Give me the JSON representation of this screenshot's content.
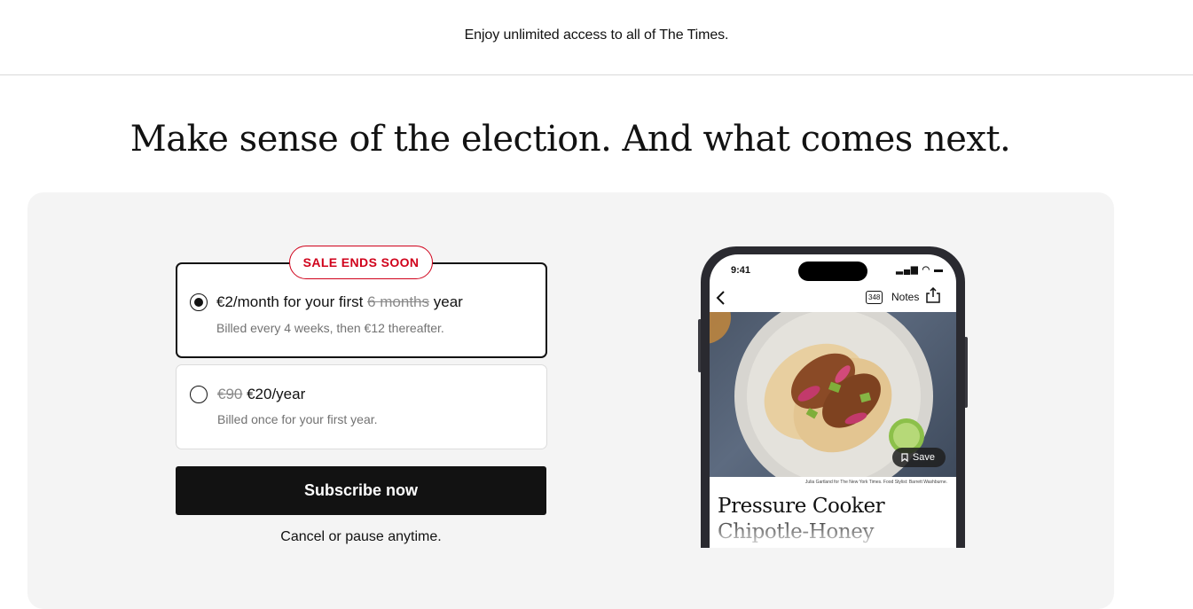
{
  "topbar": {
    "message": "Enjoy unlimited access to all of The Times."
  },
  "headline": "Make sense of the election. And what comes next.",
  "offers": {
    "badge": "SALE ENDS SOON",
    "monthly": {
      "selected": true,
      "price_prefix": "€2/month for your first ",
      "price_strike": "6 months",
      "price_suffix": " year",
      "billing": "Billed every 4 weeks, then €12 thereafter."
    },
    "yearly": {
      "selected": false,
      "old_price": "€90",
      "new_price": " €20/year",
      "billing": "Billed once for your first year."
    }
  },
  "cta": {
    "label": "Subscribe now"
  },
  "cancel_note": "Cancel or pause anytime.",
  "phone": {
    "time": "9:41",
    "status_icons": "▂▄▆ ◠ ▬",
    "notes_count": "348",
    "notes_label": "Notes",
    "save_label": "Save",
    "photo_credit": "Julia Gartland for The New York Times. Food Stylist: Barrett Washburne.",
    "article_title": "Pressure Cooker Chipotle-Honey Chicken"
  },
  "colors": {
    "accent_red": "#d0021b",
    "panel_bg": "#f4f4f4",
    "button_bg": "#121212"
  }
}
